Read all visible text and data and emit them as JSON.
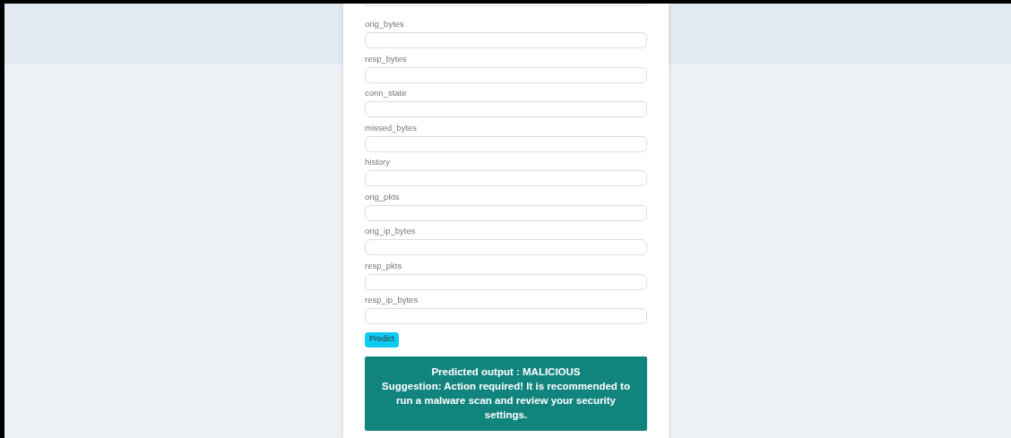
{
  "fields": [
    {
      "label": "orig_bytes"
    },
    {
      "label": "resp_bytes"
    },
    {
      "label": "conn_state"
    },
    {
      "label": "missed_bytes"
    },
    {
      "label": "history"
    },
    {
      "label": "orig_pkts"
    },
    {
      "label": "orig_ip_bytes"
    },
    {
      "label": "resp_pkts"
    },
    {
      "label": "resp_ip_bytes"
    }
  ],
  "predict_button": "Predict",
  "result": {
    "lines": [
      "Predicted output : MALICIOUS",
      "Suggestion: Action required! It is recommended to run a malware scan and review your security settings."
    ]
  }
}
